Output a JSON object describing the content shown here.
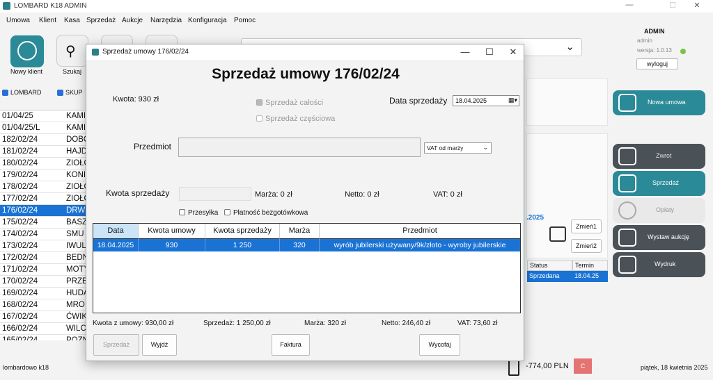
{
  "app": {
    "title": "LOMBARD K18 ADMIN",
    "menu": [
      "Umowa",
      "Klient",
      "Kasa",
      "Sprzedaż",
      "Aukcje",
      "Narzędzia",
      "Konfiguracja",
      "Pomoc"
    ],
    "toolbar": {
      "new_client": "Nowy klient",
      "search": "Szukaj"
    },
    "admin": {
      "name": "ADMIN",
      "user": "admin",
      "version": "wersja: 1.0.13",
      "logout": "wyloguj"
    },
    "filters": {
      "lombard": "LOMBARD",
      "skup": "SKUP"
    },
    "contracts": [
      {
        "no": "01/04/25",
        "name": "KAMI"
      },
      {
        "no": "01/04/25/L",
        "name": "KAMI"
      },
      {
        "no": "182/02/24",
        "name": "DOBO"
      },
      {
        "no": "181/02/24",
        "name": "HAJD"
      },
      {
        "no": "180/02/24",
        "name": "ZIOŁO"
      },
      {
        "no": "179/02/24",
        "name": "KONI"
      },
      {
        "no": "178/02/24",
        "name": "ZIOŁO"
      },
      {
        "no": "177/02/24",
        "name": "ZIOŁO"
      },
      {
        "no": "176/02/24",
        "name": "DRW",
        "selected": true
      },
      {
        "no": "175/02/24",
        "name": "BASZ"
      },
      {
        "no": "174/02/24",
        "name": "SMU"
      },
      {
        "no": "173/02/24",
        "name": "IWUL"
      },
      {
        "no": "172/02/24",
        "name": "BEDN"
      },
      {
        "no": "171/02/24",
        "name": "MOTY"
      },
      {
        "no": "170/02/24",
        "name": "PRZE"
      },
      {
        "no": "169/02/24",
        "name": "HUDA"
      },
      {
        "no": "168/02/24",
        "name": "MRO"
      },
      {
        "no": "167/02/24",
        "name": "ĆWIK"
      },
      {
        "no": "166/02/24",
        "name": "WILC"
      },
      {
        "no": "165/02/24",
        "name": "POZN"
      }
    ],
    "right_buttons": {
      "new_contract": "Nowa umowa",
      "return": "Zwrot",
      "sale": "Sprzedaż",
      "fees": "Opłaty",
      "auction": "Wystaw aukcję",
      "print": "Wydruk"
    },
    "bg_year_fragment": ".2025",
    "bg_table": {
      "status_header": "Status",
      "term_header": "Termin",
      "status": "Sprzedana",
      "term": "18.04.25"
    },
    "change_buttons": [
      "Zmień1",
      "Zmień2"
    ],
    "status": {
      "left": "lombardowo k18",
      "cash": "-774,00 PLN",
      "cash_button": "C",
      "date": "piątek, 18 kwietnia 2025"
    }
  },
  "dialog": {
    "title": "Sprzedaż umowy 176/02/24",
    "heading": "Sprzedaż umowy 176/02/24",
    "amount_label": "Kwota: 930 zł",
    "sale_whole": "Sprzedaż całości",
    "sale_partial": "Sprzedaż częściowa",
    "sale_date_label": "Data sprzedaży",
    "sale_date": "18.04.2025",
    "item_label": "Przedmiot",
    "vat_option": "VAT od marży",
    "sale_amount_label": "Kwota sprzedaży",
    "margin": "Marża: 0 zł",
    "net": "Netto: 0 zł",
    "vat": "VAT: 0 zł",
    "shipping": "Przesyłka",
    "cashless": "Płatność bezgotówkowa",
    "grid": {
      "headers": [
        "Data",
        "Kwota umowy",
        "Kwota sprzedaży",
        "Marża",
        "Przedmiot"
      ],
      "rows": [
        [
          "18.04.2025",
          "930",
          "1 250",
          "320",
          "wyrób jubilerski używany/9k/złoto - wyroby jubilerskie"
        ]
      ]
    },
    "summary": {
      "contract_amount": "Kwota z umowy: 930,00 zł",
      "sale": "Sprzedaż: 1 250,00 zł",
      "margin": "Marża: 320 zł",
      "net": "Netto: 246,40 zł",
      "vat": "VAT: 73,60 zł"
    },
    "buttons": {
      "sell": "Sprzedaż",
      "exit": "Wyjdź",
      "invoice": "Faktura",
      "undo": "Wycofaj"
    }
  }
}
